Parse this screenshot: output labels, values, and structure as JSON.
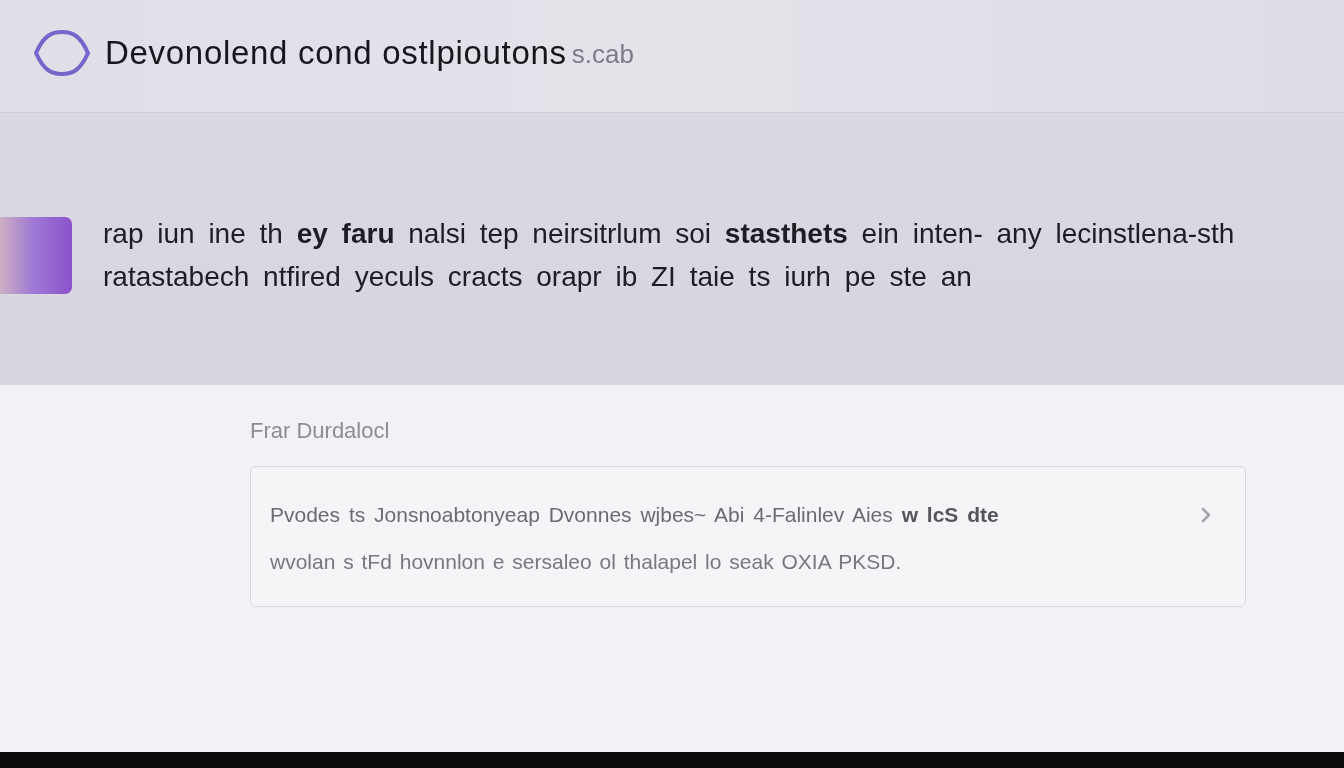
{
  "header": {
    "title": "Devonolend cond ostlpioutons",
    "subtitle": "s.cab"
  },
  "banner": {
    "text": "rap iun ine th **ey faru** nalsi tep neirsitrlum soi **stasthets** ein inten- any lecinstlena-sth ratastabech ntfired yeculs cracts orapr ib ZI taie ts iurh pe ste an"
  },
  "section": {
    "label": "Frar Durdalocl",
    "card": {
      "title": "Pvodes ts Jonsnoabtonyeap Dvonnes wjbes~ Abi 4-Falinlev Aies **w lcS dte**",
      "detail": "wvolan s tFd hovnnlon e sersaleo ol thalapel lo seak OXIA PKSD."
    }
  }
}
